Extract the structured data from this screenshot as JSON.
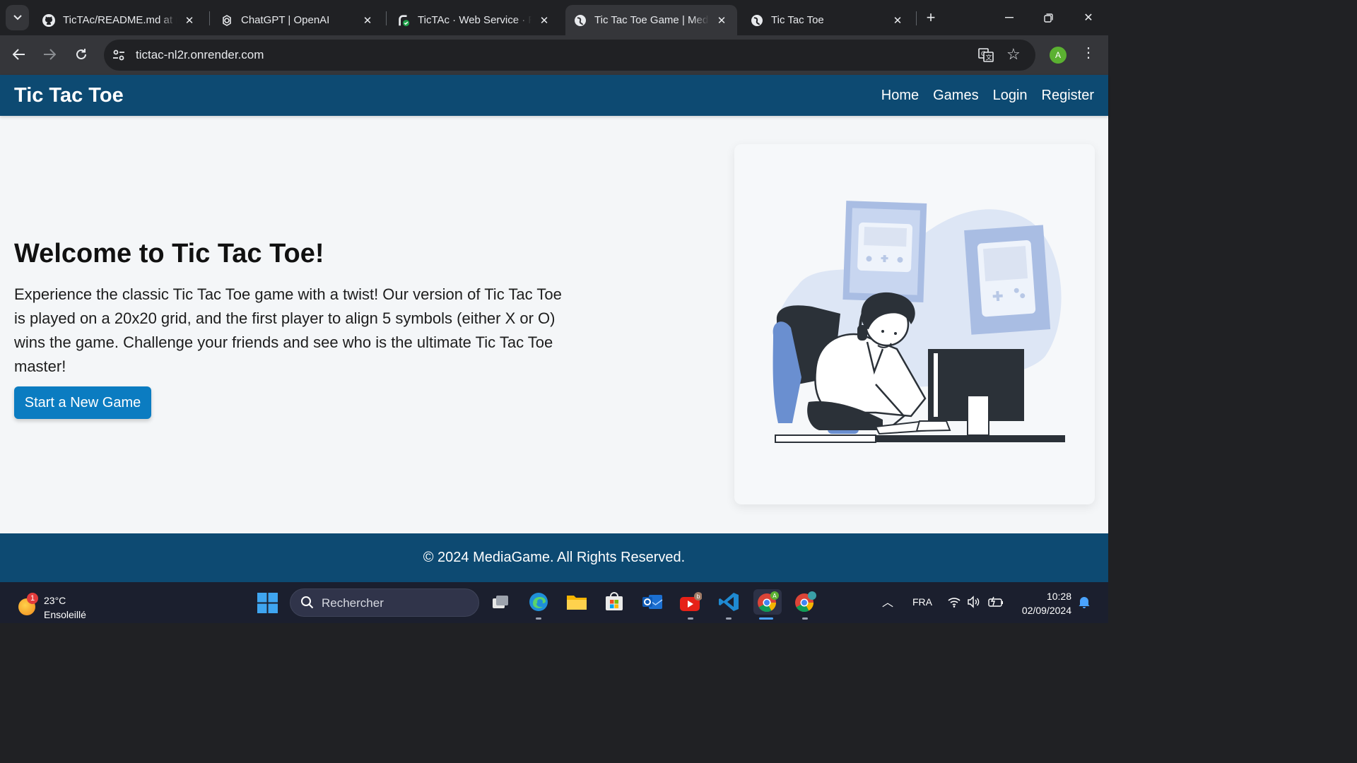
{
  "browser": {
    "tabs": [
      {
        "title": "TicTAc/README.md at main",
        "icon": "github-icon"
      },
      {
        "title": "ChatGPT | OpenAI",
        "icon": "openai-icon"
      },
      {
        "title": "TicTAc · Web Service · Render",
        "icon": "render-icon"
      },
      {
        "title": "Tic Tac Toe Game | MediaGame",
        "icon": "globe-icon",
        "active": true
      },
      {
        "title": "Tic Tac Toe",
        "icon": "globe-icon"
      }
    ],
    "url": "tictac-nl2r.onrender.com",
    "profile_initial": "A"
  },
  "site": {
    "brand": "Tic Tac Toe",
    "nav": [
      "Home",
      "Games",
      "Login",
      "Register"
    ],
    "hero_title": "Welcome to Tic Tac Toe!",
    "hero_text": "Experience the classic Tic Tac Toe game with a twist! Our version of Tic Tac Toe is played on a 20x20 grid, and the first player to align 5 symbols (either X or O) wins the game. Challenge your friends and see who is the ultimate Tic Tac Toe master!",
    "cta_label": "Start a New Game",
    "footer": "© 2024 MediaGame. All Rights Reserved.",
    "colors": {
      "header": "#0d4a72",
      "button": "#0b7cc1",
      "background": "#f4f6f8"
    }
  },
  "taskbar": {
    "weather_temp": "23°C",
    "weather_cond": "Ensoleillé",
    "weather_badge": "1",
    "search_placeholder": "Rechercher",
    "apps": [
      "task-view-icon",
      "edge-icon",
      "file-explorer-icon",
      "store-icon",
      "outlook-icon",
      "youtube-icon",
      "vscode-icon",
      "chrome-icon",
      "chrome-icon"
    ],
    "language": "FRA",
    "time": "10:28",
    "date": "02/09/2024"
  }
}
